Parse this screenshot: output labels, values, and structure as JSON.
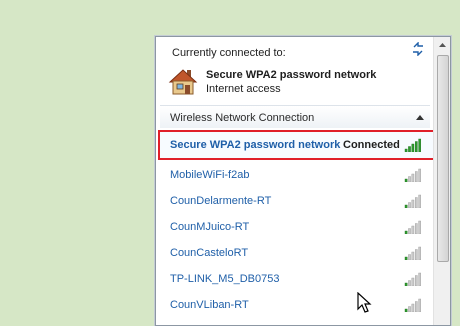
{
  "header": {
    "currently_label": "Currently connected to:",
    "connection_name": "Secure WPA2 password network",
    "connection_status": "Internet access"
  },
  "section": {
    "label": "Wireless Network Connection"
  },
  "networks": [
    {
      "name": "Secure WPA2 password network",
      "state": "Connected",
      "signal_bars": 5,
      "active": true
    },
    {
      "name": "MobileWiFi-f2ab",
      "signal_bars": 1
    },
    {
      "name": "CounDelarmente-RT",
      "signal_bars": 1
    },
    {
      "name": "CounMJuico-RT",
      "signal_bars": 1
    },
    {
      "name": "CounCasteloRT",
      "signal_bars": 1
    },
    {
      "name": "TP-LINK_M5_DB0753",
      "signal_bars": 1
    },
    {
      "name": "CounVLiban-RT",
      "signal_bars": 1
    }
  ],
  "icons": {
    "refresh": "refresh-icon",
    "house": "house-icon",
    "collapse": "chevron-up-icon",
    "signal": "signal-icon",
    "cursor": "mouse-cursor-icon"
  },
  "colors": {
    "background": "#d6e7c6",
    "link_blue": "#1f5fa8",
    "highlight_red": "#e0202a",
    "signal_green": "#2e9a2e"
  }
}
